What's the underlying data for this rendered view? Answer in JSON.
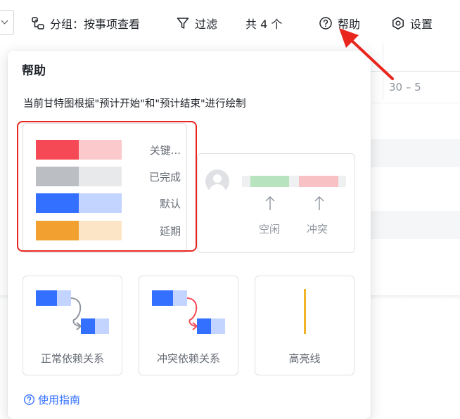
{
  "toolbar": {
    "group_label": "分组：按事项查看",
    "filter_label": "过滤",
    "count_label": "共 4 个",
    "help_label": "帮助",
    "settings_label": "设置"
  },
  "background": {
    "date_header": "30 – 5"
  },
  "help_popover": {
    "title": "帮助",
    "description": "当前甘特图根据\"预计开始\"和\"预计结束\"进行绘制",
    "legend": [
      {
        "label": "关键...",
        "color_dark": "#f54a55",
        "color_light": "#fbc9cb"
      },
      {
        "label": "已完成",
        "color_dark": "#bbbfc4",
        "color_light": "#e8e9eb"
      },
      {
        "label": "默认",
        "color_dark": "#3370ff",
        "color_light": "#c2d4ff"
      },
      {
        "label": "延期",
        "color_dark": "#f2a130",
        "color_light": "#fce4c6"
      }
    ],
    "resource": {
      "free_label": "空闲",
      "conflict_label": "冲突"
    },
    "cards": {
      "normal_dependency": "正常依赖关系",
      "conflict_dependency": "冲突依赖关系",
      "highlight_line": "高亮线"
    },
    "guide_link": "使用指南"
  },
  "colors": {
    "accent": "#3370ff",
    "annotation_red": "#e8261e",
    "highlight_line": "#f0b429"
  }
}
